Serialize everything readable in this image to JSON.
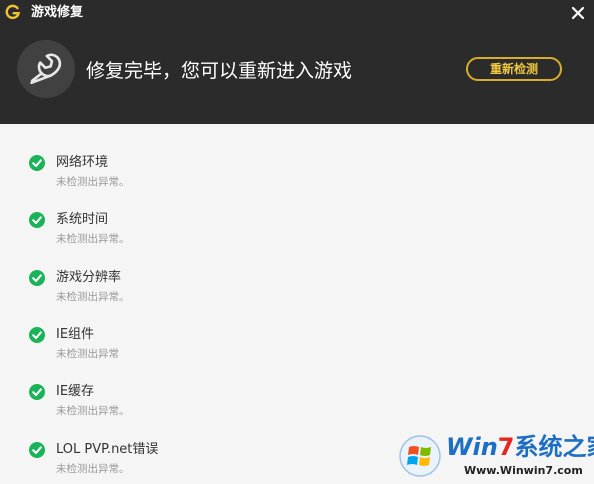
{
  "window": {
    "title": "游戏修复"
  },
  "header": {
    "status_title": "修复完毕，您可以重新进入游戏",
    "rescan_label": "重新检测"
  },
  "check_items": [
    {
      "name": "网络环境",
      "desc": "未检测出异常。"
    },
    {
      "name": "系统时间",
      "desc": "未检测出异常。"
    },
    {
      "name": "游戏分辨率",
      "desc": "未检测出异常。"
    },
    {
      "name": "IE组件",
      "desc": "未检测出异常"
    },
    {
      "name": "IE缓存",
      "desc": "未检测出异常。"
    },
    {
      "name": "LOL PVP.net错误",
      "desc": "未检测出异常。"
    }
  ],
  "watermark": {
    "title_win": "Win",
    "title_seven": "7",
    "title_rest": "系统之家",
    "url": "Www.Winwin7.com"
  },
  "colors": {
    "header_bg": "#2b2b2b",
    "accent_gold": "#d9ad2b",
    "check_green": "#1ab35a",
    "body_bg": "#f5f5f5"
  }
}
